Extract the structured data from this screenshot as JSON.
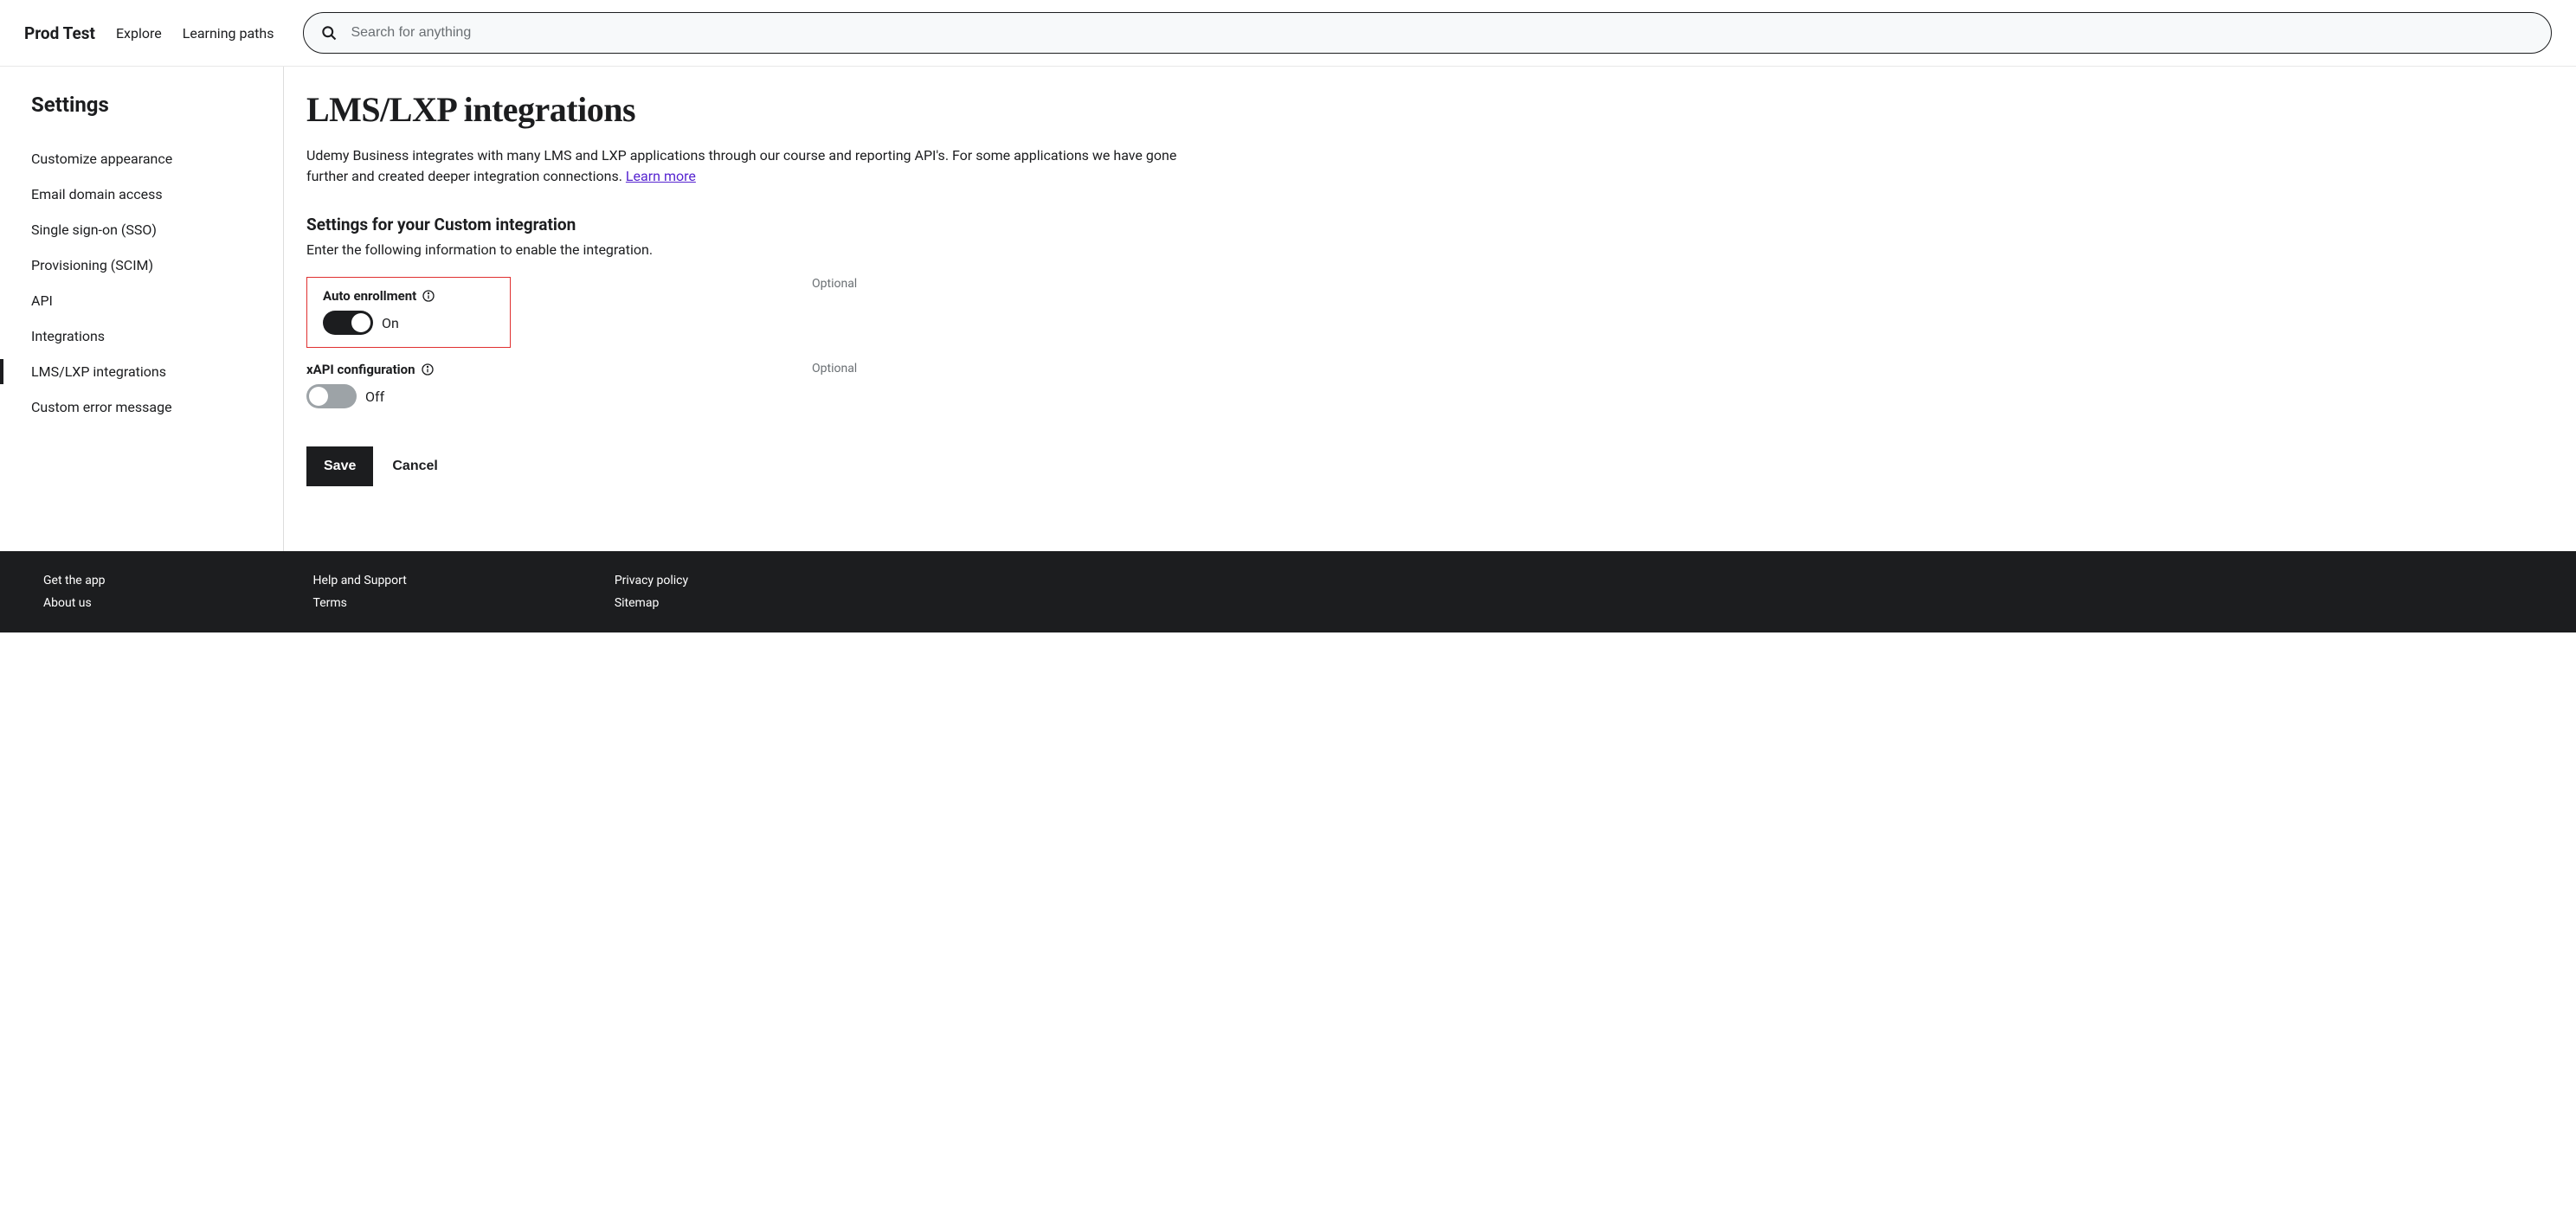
{
  "header": {
    "brand": "Prod Test",
    "nav": {
      "explore": "Explore",
      "learning_paths": "Learning paths"
    },
    "search_placeholder": "Search for anything"
  },
  "sidebar": {
    "title": "Settings",
    "items": [
      {
        "label": "Customize appearance"
      },
      {
        "label": "Email domain access"
      },
      {
        "label": "Single sign-on (SSO)"
      },
      {
        "label": "Provisioning (SCIM)"
      },
      {
        "label": "API"
      },
      {
        "label": "Integrations"
      },
      {
        "label": "LMS/LXP integrations"
      },
      {
        "label": "Custom error message"
      }
    ]
  },
  "main": {
    "title": "LMS/LXP integrations",
    "intro_prefix": "Udemy Business integrates with many LMS and LXP applications through our course and reporting API's. For some applications we have gone further and created deeper integration connections. ",
    "learn_more": "Learn more",
    "section_title": "Settings for your Custom integration",
    "section_sub": "Enter the following information to enable the integration.",
    "optional": "Optional",
    "auto_enrollment": {
      "label": "Auto enrollment",
      "state": "On"
    },
    "xapi": {
      "label": "xAPI configuration",
      "state": "Off"
    },
    "buttons": {
      "save": "Save",
      "cancel": "Cancel"
    }
  },
  "footer": {
    "col1": {
      "get_app": "Get the app",
      "about": "About us"
    },
    "col2": {
      "help": "Help and Support",
      "terms": "Terms"
    },
    "col3": {
      "privacy": "Privacy policy",
      "sitemap": "Sitemap"
    }
  }
}
